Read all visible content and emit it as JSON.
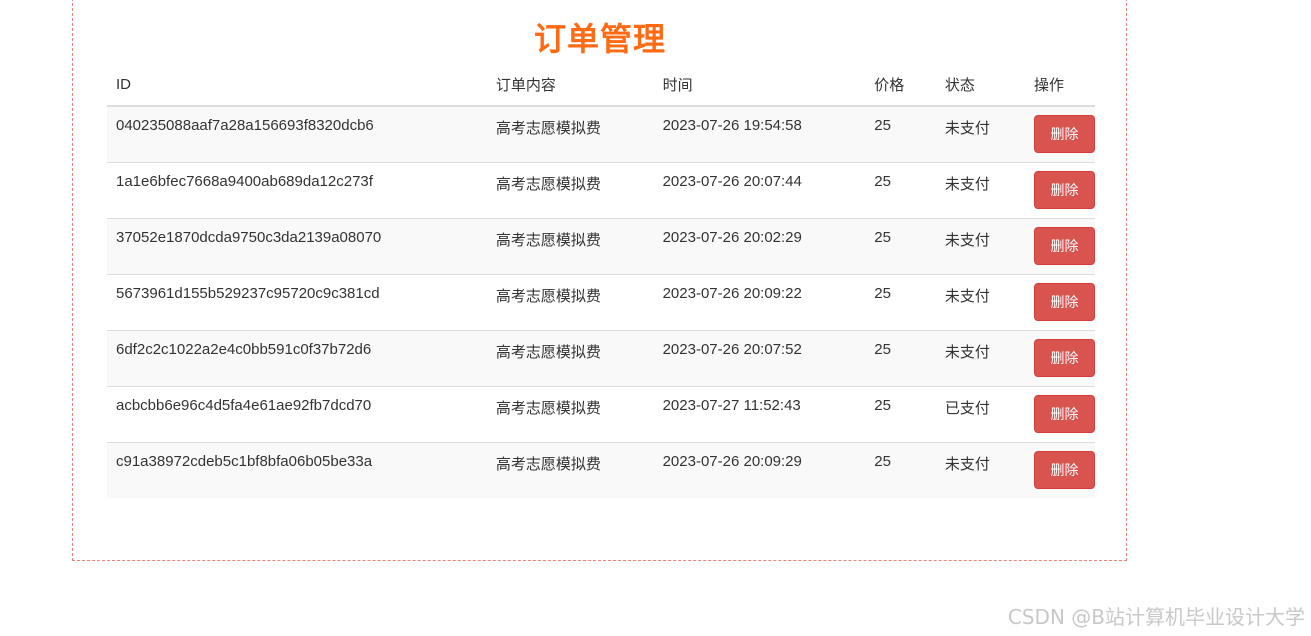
{
  "page": {
    "title": "订单管理"
  },
  "table": {
    "headers": {
      "id": "ID",
      "content": "订单内容",
      "time": "时间",
      "price": "价格",
      "status": "状态",
      "action": "操作"
    },
    "rows": [
      {
        "id": "040235088aaf7a28a156693f8320dcb6",
        "content": "高考志愿模拟费",
        "time": "2023-07-26 19:54:58",
        "price": "25",
        "status": "未支付",
        "action": "删除"
      },
      {
        "id": "1a1e6bfec7668a9400ab689da12c273f",
        "content": "高考志愿模拟费",
        "time": "2023-07-26 20:07:44",
        "price": "25",
        "status": "未支付",
        "action": "删除"
      },
      {
        "id": "37052e1870dcda9750c3da2139a08070",
        "content": "高考志愿模拟费",
        "time": "2023-07-26 20:02:29",
        "price": "25",
        "status": "未支付",
        "action": "删除"
      },
      {
        "id": "5673961d155b529237c95720c9c381cd",
        "content": "高考志愿模拟费",
        "time": "2023-07-26 20:09:22",
        "price": "25",
        "status": "未支付",
        "action": "删除"
      },
      {
        "id": "6df2c2c1022a2e4c0bb591c0f37b72d6",
        "content": "高考志愿模拟费",
        "time": "2023-07-26 20:07:52",
        "price": "25",
        "status": "未支付",
        "action": "删除"
      },
      {
        "id": "acbcbb6e96c4d5fa4e61ae92fb7dcd70",
        "content": "高考志愿模拟费",
        "time": "2023-07-27 11:52:43",
        "price": "25",
        "status": "已支付",
        "action": "删除"
      },
      {
        "id": "c91a38972cdeb5c1bf8bfa06b05be33a",
        "content": "高考志愿模拟费",
        "time": "2023-07-26 20:09:29",
        "price": "25",
        "status": "未支付",
        "action": "删除"
      }
    ]
  },
  "watermark": "CSDN @B站计算机毕业设计大学",
  "colors": {
    "title": "#ff6a13",
    "delete_button": "#d9534f",
    "frame_border": "#e9847a",
    "stripe": "#f9f9f9"
  }
}
